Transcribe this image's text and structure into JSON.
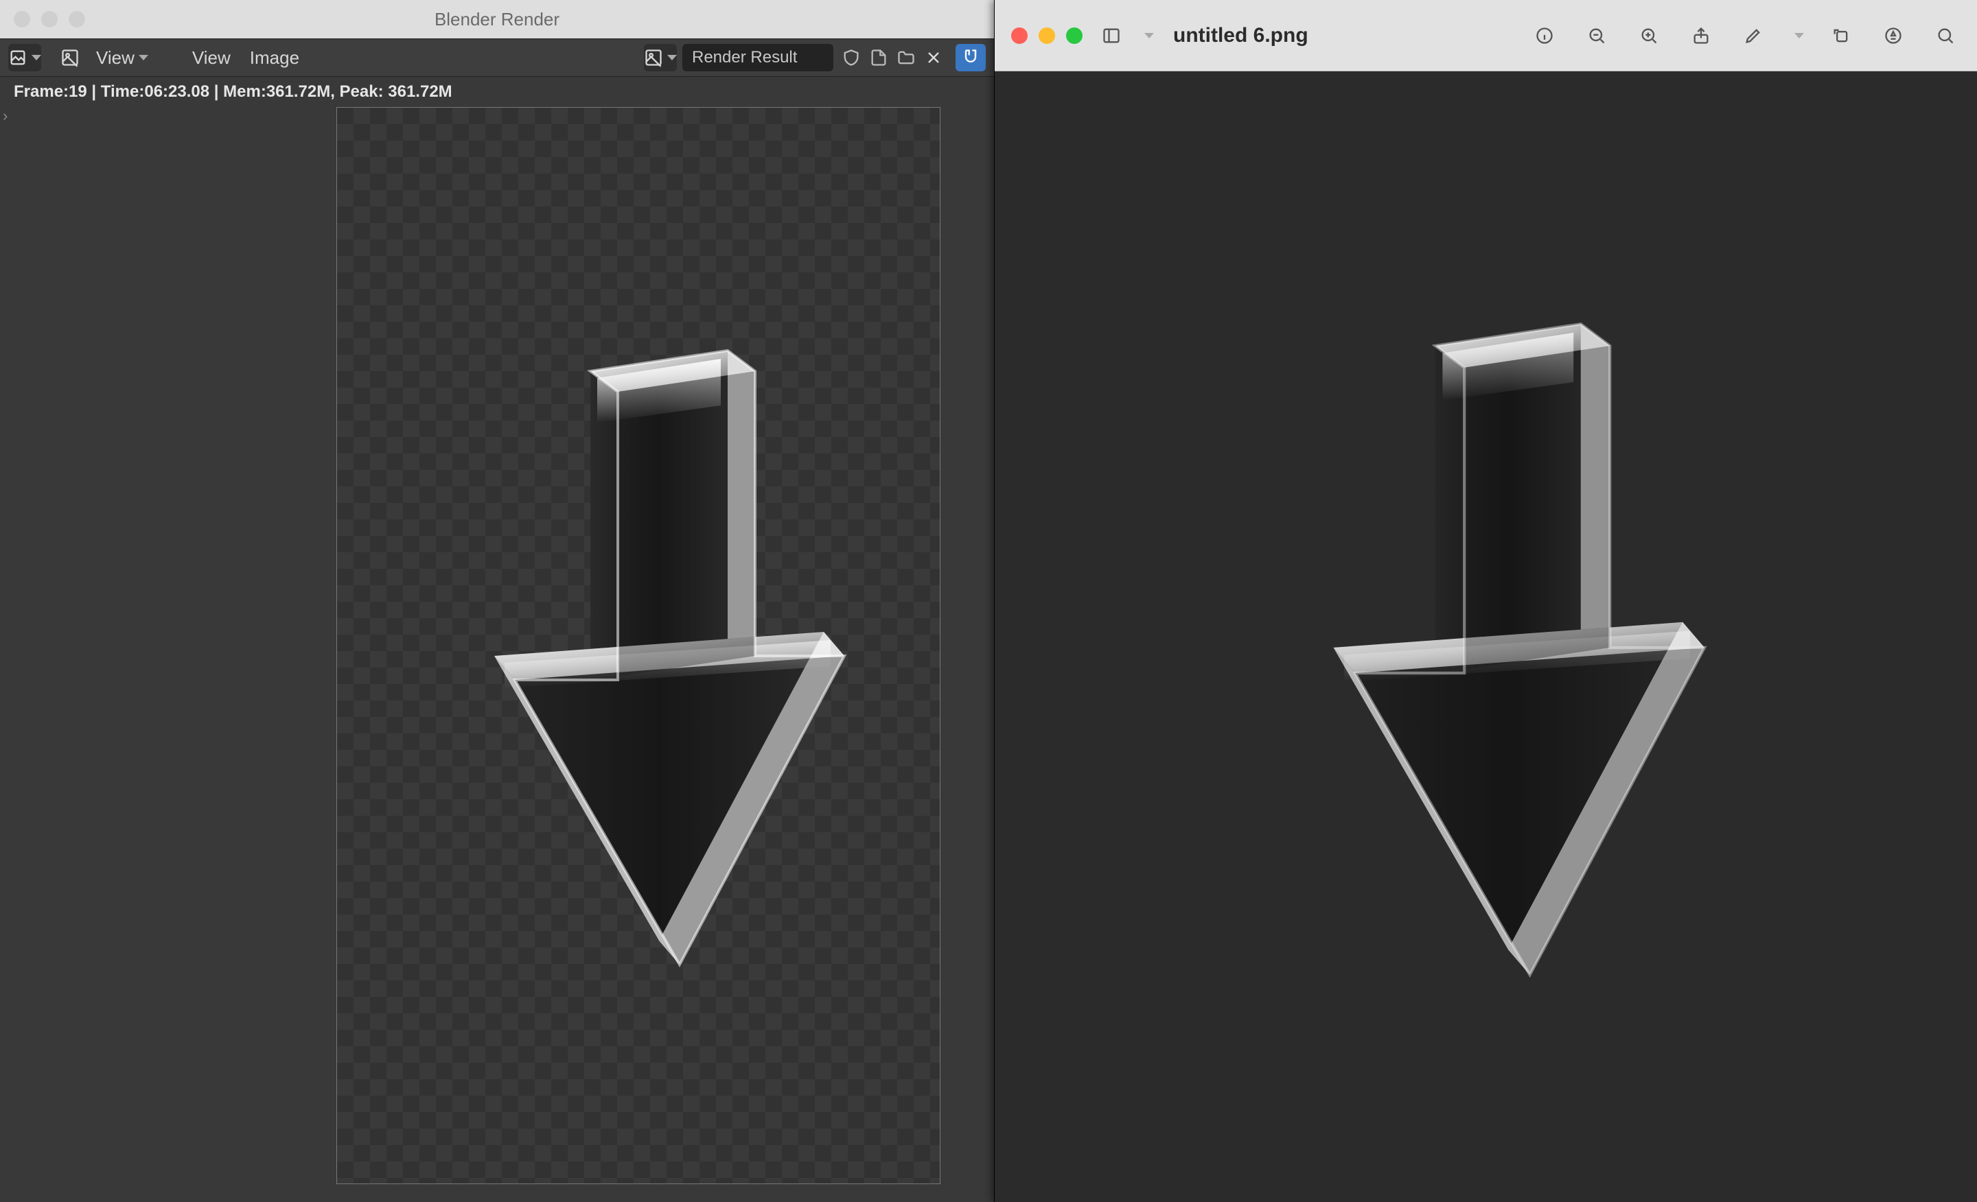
{
  "blender": {
    "title": "Blender Render",
    "toolbar": {
      "view1": "View",
      "view2": "View",
      "image": "Image",
      "slot_label": "Render Result"
    },
    "status": "Frame:19 | Time:06:23.08 | Mem:361.72M, Peak: 361.72M"
  },
  "preview": {
    "filename": "untitled 6.png"
  }
}
